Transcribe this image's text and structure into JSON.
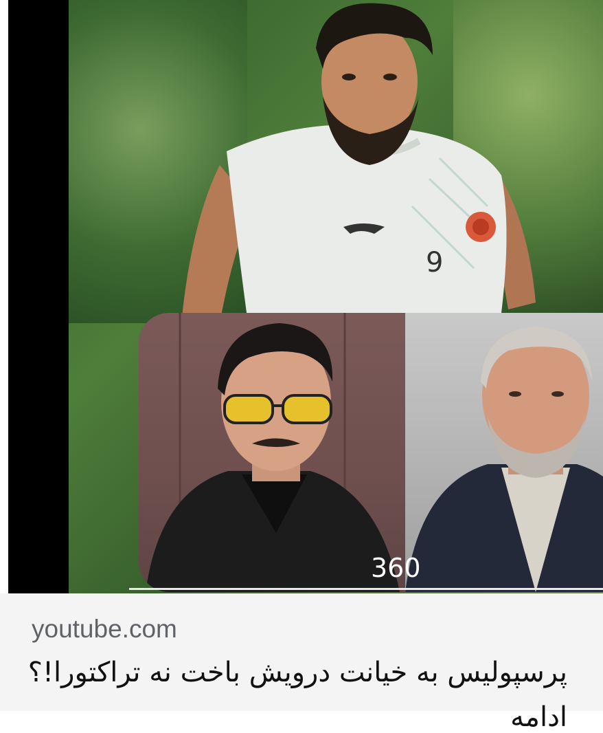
{
  "result_card": {
    "thumbnail": {
      "jersey_number": "9",
      "logo_text": "360"
    },
    "source": "youtube.com",
    "headline": "پرسپولیس به خیانت درویش باخت نه تراکتورا!؟",
    "headline_line2": "ادامه"
  },
  "colors": {
    "caption_bg": "#f4f4f4",
    "source_text": "#5f6368",
    "headline_text": "#111111"
  }
}
